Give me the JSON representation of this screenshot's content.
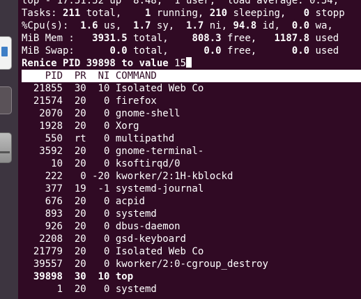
{
  "summary": {
    "top_line": "top - 17:51:52 up  8:48,  1 user,  load average: 0.54,",
    "tasks": {
      "label": "Tasks:",
      "total": "211",
      "total_label": " total,   ",
      "running": "1",
      "running_label": " running, ",
      "sleeping": "210",
      "sleeping_label": " sleeping,   ",
      "stopped": "0",
      "stopped_label": " stopp"
    },
    "cpu": {
      "label": "%Cpu(s):  ",
      "us": "1.6",
      "us_label": " us,  ",
      "sy": "1.7",
      "sy_label": " sy,  ",
      "ni": "1.7",
      "ni_label": " ni, ",
      "id": "94.8",
      "id_label": " id,  ",
      "wa": "0.0",
      "wa_label": " wa,"
    },
    "mem": {
      "label": "MiB Mem :   ",
      "total": "3931.5",
      "total_label": " total,    ",
      "free": "808.3",
      "free_label": " free,   ",
      "used": "1187.8",
      "used_label": " used"
    },
    "swap": {
      "label": "MiB Swap:      ",
      "total": "0.0",
      "total_label": " total,      ",
      "free": "0.0",
      "free_label": " free,      ",
      "used": "0.0",
      "used_label": " used"
    }
  },
  "prompt": {
    "text": "Renice PID 39898 to value ",
    "input": "15"
  },
  "table": {
    "header": "    PID  PR  NI COMMAND",
    "rows": [
      {
        "pid": "21855",
        "pr": "30",
        "ni": "10",
        "command": "Isolated Web Co"
      },
      {
        "pid": "21574",
        "pr": "20",
        "ni": "0",
        "command": "firefox"
      },
      {
        "pid": "2070",
        "pr": "20",
        "ni": "0",
        "command": "gnome-shell"
      },
      {
        "pid": "1928",
        "pr": "20",
        "ni": "0",
        "command": "Xorg"
      },
      {
        "pid": "550",
        "pr": "rt",
        "ni": "0",
        "command": "multipathd"
      },
      {
        "pid": "3592",
        "pr": "20",
        "ni": "0",
        "command": "gnome-terminal-"
      },
      {
        "pid": "10",
        "pr": "20",
        "ni": "0",
        "command": "ksoftirqd/0"
      },
      {
        "pid": "222",
        "pr": "0",
        "ni": "-20",
        "command": "kworker/2:1H-kblockd"
      },
      {
        "pid": "377",
        "pr": "19",
        "ni": "-1",
        "command": "systemd-journal"
      },
      {
        "pid": "676",
        "pr": "20",
        "ni": "0",
        "command": "acpid"
      },
      {
        "pid": "893",
        "pr": "20",
        "ni": "0",
        "command": "systemd"
      },
      {
        "pid": "926",
        "pr": "20",
        "ni": "0",
        "command": "dbus-daemon"
      },
      {
        "pid": "2208",
        "pr": "20",
        "ni": "0",
        "command": "gsd-keyboard"
      },
      {
        "pid": "21779",
        "pr": "20",
        "ni": "0",
        "command": "Isolated Web Co"
      },
      {
        "pid": "39557",
        "pr": "20",
        "ni": "0",
        "command": "kworker/2:0-cgroup_destroy"
      },
      {
        "pid": "39898",
        "pr": "30",
        "ni": "10",
        "command": "top",
        "highlight": true
      },
      {
        "pid": "1",
        "pr": "20",
        "ni": "0",
        "command": "systemd"
      }
    ]
  },
  "dock": {
    "items": [
      {
        "icon": "document-icon"
      },
      {
        "icon": "app-icon"
      },
      {
        "icon": "disk-icon"
      }
    ]
  },
  "colors": {
    "terminal_bg": "#300a24",
    "dock_bg": "#3d3540",
    "text": "#ffffff"
  }
}
